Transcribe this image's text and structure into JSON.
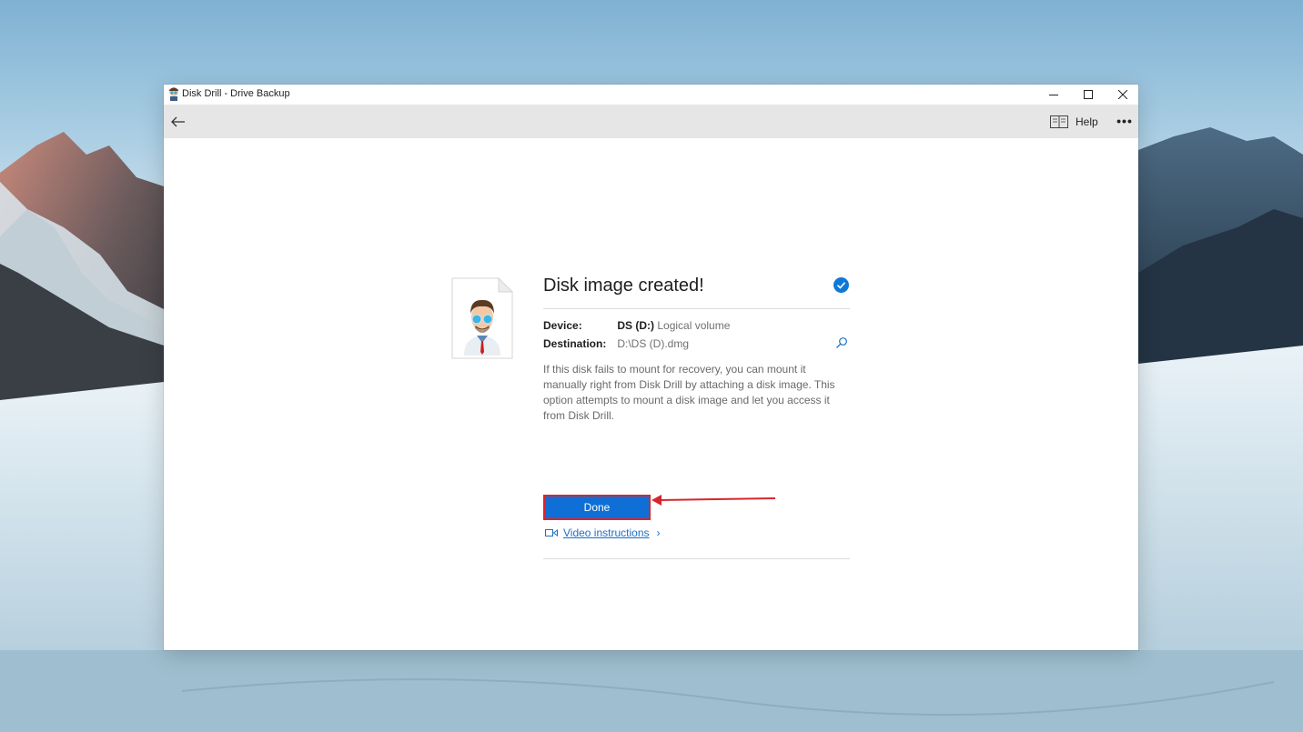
{
  "window": {
    "title": "Disk Drill - Drive Backup"
  },
  "toolbar": {
    "help_label": "Help",
    "more_label": "•••"
  },
  "dialog": {
    "heading": "Disk image created!",
    "device_label": "Device:",
    "device_name": "DS (D:)",
    "device_type": "Logical volume",
    "destination_label": "Destination:",
    "destination_value": "D:\\DS (D).dmg",
    "description": "If this disk fails to mount for recovery, you can mount it manually right from Disk Drill by attaching a disk image. This option attempts to mount a disk image and let you access it from Disk Drill.",
    "video_link": "Video instructions",
    "video_chevron": "›",
    "done_label": "Done"
  },
  "colors": {
    "accent": "#0f6fd6",
    "highlight_annotation": "#d7262c",
    "link": "#1a6fc8",
    "toolbar_bg": "#e6e6e6"
  }
}
